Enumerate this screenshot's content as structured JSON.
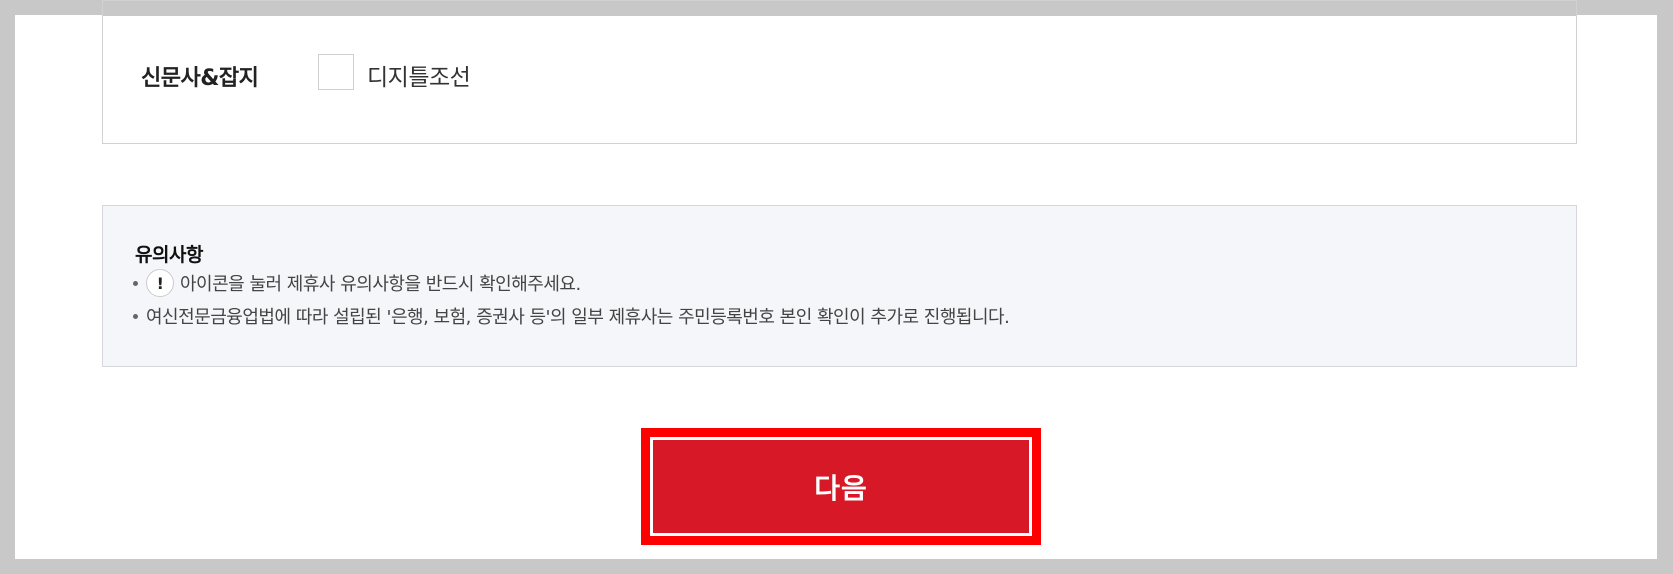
{
  "media_section": {
    "label": "신문사&잡지",
    "options": [
      {
        "label": "디지틀조선",
        "checked": false
      }
    ]
  },
  "notice": {
    "title": "유의사항",
    "items": [
      {
        "icon": "exclamation-icon",
        "icon_glyph": "!",
        "text": "아이콘을 눌러 제휴사 유의사항을 반드시 확인해주세요."
      },
      {
        "text": "여신전문금융업법에 따라 설립된 '은행, 보험, 증권사 등'의 일부 제휴사는 주민등록번호 본인 확인이 추가로 진행됩니다."
      }
    ]
  },
  "next_button": {
    "label": "다음"
  },
  "colors": {
    "button_red": "#d71826",
    "highlight_outline": "#ff0000",
    "notice_bg": "#f5f6f9"
  }
}
